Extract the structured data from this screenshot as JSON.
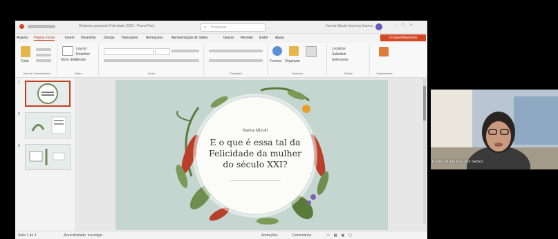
{
  "window": {
    "title": "Dinâmica propósito Felicidade 2023 - PowerPoint",
    "search_placeholder": "Pesquisar",
    "user_name": "Karina Mizuki Imai dos Santos"
  },
  "menu": {
    "items": [
      "Arquivo",
      "Página Inicial",
      "Inserir",
      "Desenhar",
      "Design",
      "Transições",
      "Animações",
      "Apresentação de Slides",
      "Gravar",
      "Revisão",
      "Exibir",
      "Ajuda"
    ],
    "share_label": "Compartilhamento"
  },
  "ribbon": {
    "clipboard": {
      "paste": "Colar",
      "label": "Área de Transferência"
    },
    "slides": {
      "new": "Novo Slide",
      "layout": "Layout",
      "reset": "Redefinir",
      "section": "Seção",
      "label": "Slides"
    },
    "font": {
      "label": "Fonte"
    },
    "paragraph": {
      "label": "Parágrafo"
    },
    "drawing": {
      "shapes": "Formas",
      "arrange": "Organizar",
      "quick": "Estilos Rápidos",
      "label": "Desenho"
    },
    "editing": {
      "find": "Localizar",
      "replace": "Substituir",
      "select": "Selecionar",
      "label": "Edição"
    },
    "addins": {
      "label": "Suplementos"
    }
  },
  "thumbnails": [
    "1",
    "2",
    "3"
  ],
  "slide": {
    "author": "Karina Mizuki",
    "title_lines": [
      "E o que é essa tal da",
      "Felicidade da mulher",
      "do século XXI?"
    ]
  },
  "status": {
    "slide": "Slide 1 de 3",
    "access": "Acessibilidade: investigar",
    "notes": "Anotações",
    "comments": "Comentários"
  },
  "camera": {
    "participant": "Karina Mizuki Imai dos Santos"
  },
  "colors": {
    "accent": "#d24726",
    "slide_bg": "#c5d6d0",
    "leaf_green": "#5a7a3a",
    "leaf_red": "#b8402a"
  }
}
